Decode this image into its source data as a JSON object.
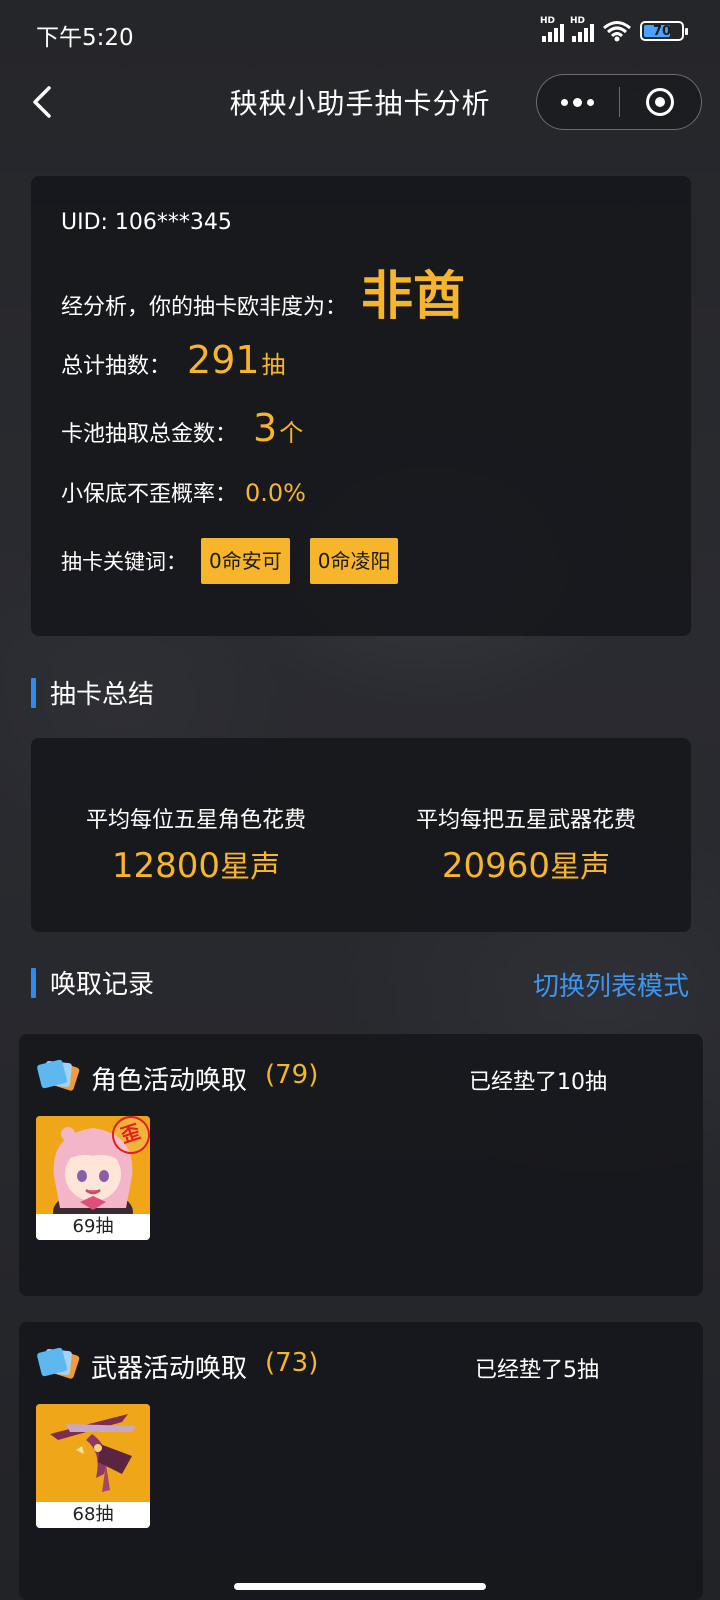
{
  "status_bar": {
    "time": "下午5:20",
    "signal_tag_1": "HD",
    "signal_tag_2": "HD",
    "battery": "70"
  },
  "nav": {
    "title": "秧秧小助手抽卡分析"
  },
  "analysis": {
    "uid": "UID: 106***345",
    "verdict_label": "经分析，你的抽卡欧非度为：",
    "verdict_value": "非酋",
    "total_label": "总计抽数：",
    "total_value": "291",
    "total_unit": "抽",
    "gold_label": "卡池抽取总金数：",
    "gold_value": "3",
    "gold_unit": "个",
    "rate_label": "小保底不歪概率：",
    "rate_value": "0.0%",
    "keywords_label": "抽卡关键词：",
    "keywords": [
      "0命安可",
      "0命凌阳"
    ]
  },
  "summary": {
    "section_title": "抽卡总结",
    "avg_character_label": "平均每位五星角色花费",
    "avg_character_value": "12800",
    "avg_character_unit": "星声",
    "avg_weapon_label": "平均每把五星武器花费",
    "avg_weapon_value": "20960",
    "avg_weapon_unit": "星声"
  },
  "records": {
    "section_title": "唤取记录",
    "switch_mode_label": "切换列表模式",
    "pools": [
      {
        "title": "角色活动唤取",
        "count": "(79)",
        "pity": "已经垫了10抽",
        "items": [
          {
            "pulls": "69抽",
            "stamp": "歪"
          }
        ]
      },
      {
        "title": "武器活动唤取",
        "count": "(73)",
        "pity": "已经垫了5抽",
        "items": [
          {
            "pulls": "68抽"
          }
        ]
      }
    ]
  },
  "colors": {
    "accent_gold": "#f7b52c",
    "accent_blue": "#2d8cf0",
    "background": "#232428"
  }
}
